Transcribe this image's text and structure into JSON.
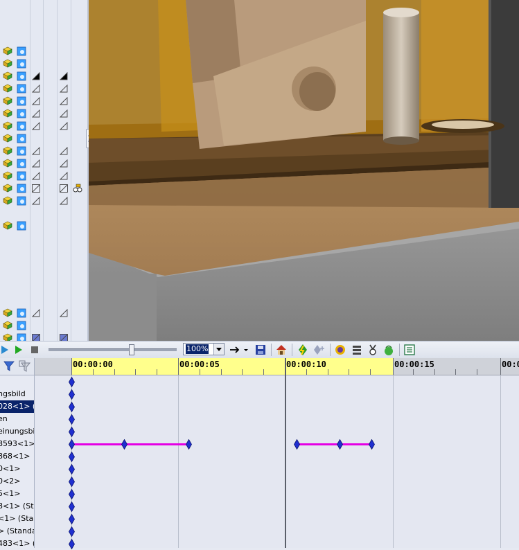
{
  "viewport": {
    "description_icons": [
      "3d-model-view"
    ]
  },
  "toolbar": {
    "zoom_value": "100%",
    "icons": [
      "play-icon",
      "play-green-icon",
      "stop-icon",
      "slider",
      "arrow-icon",
      "save-icon",
      "home-icon",
      "autokey-icon",
      "add-key-icon",
      "smart-icon",
      "stack-icon",
      "medal-icon",
      "bag-icon",
      "table-icon"
    ]
  },
  "timeline": {
    "ticks": [
      "00:00:00",
      "00:00:05",
      "00:00:10",
      "00:00:15",
      "00:0"
    ],
    "rows": [
      {
        "label": ""
      },
      {
        "label": "ngsbild"
      },
      {
        "label": "028<1> (S",
        "selected": true
      },
      {
        "label": "en"
      },
      {
        "label": "einungsbild"
      },
      {
        "label": "8593<1>"
      },
      {
        "label": "868<1>"
      },
      {
        "label": "0<1>"
      },
      {
        "label": "0<2>"
      },
      {
        "label": "5<1>"
      },
      {
        "label": "8<1> (Sta"
      },
      {
        "label": "<1> (Stan"
      },
      {
        "label": "> (Standa"
      },
      {
        "label": "483<1> (S"
      }
    ]
  },
  "colors": {
    "selection": "#0a246a",
    "track": "#e400e4",
    "ruler_active": "#ffff8c",
    "keyframe": "#1f2fd0"
  }
}
